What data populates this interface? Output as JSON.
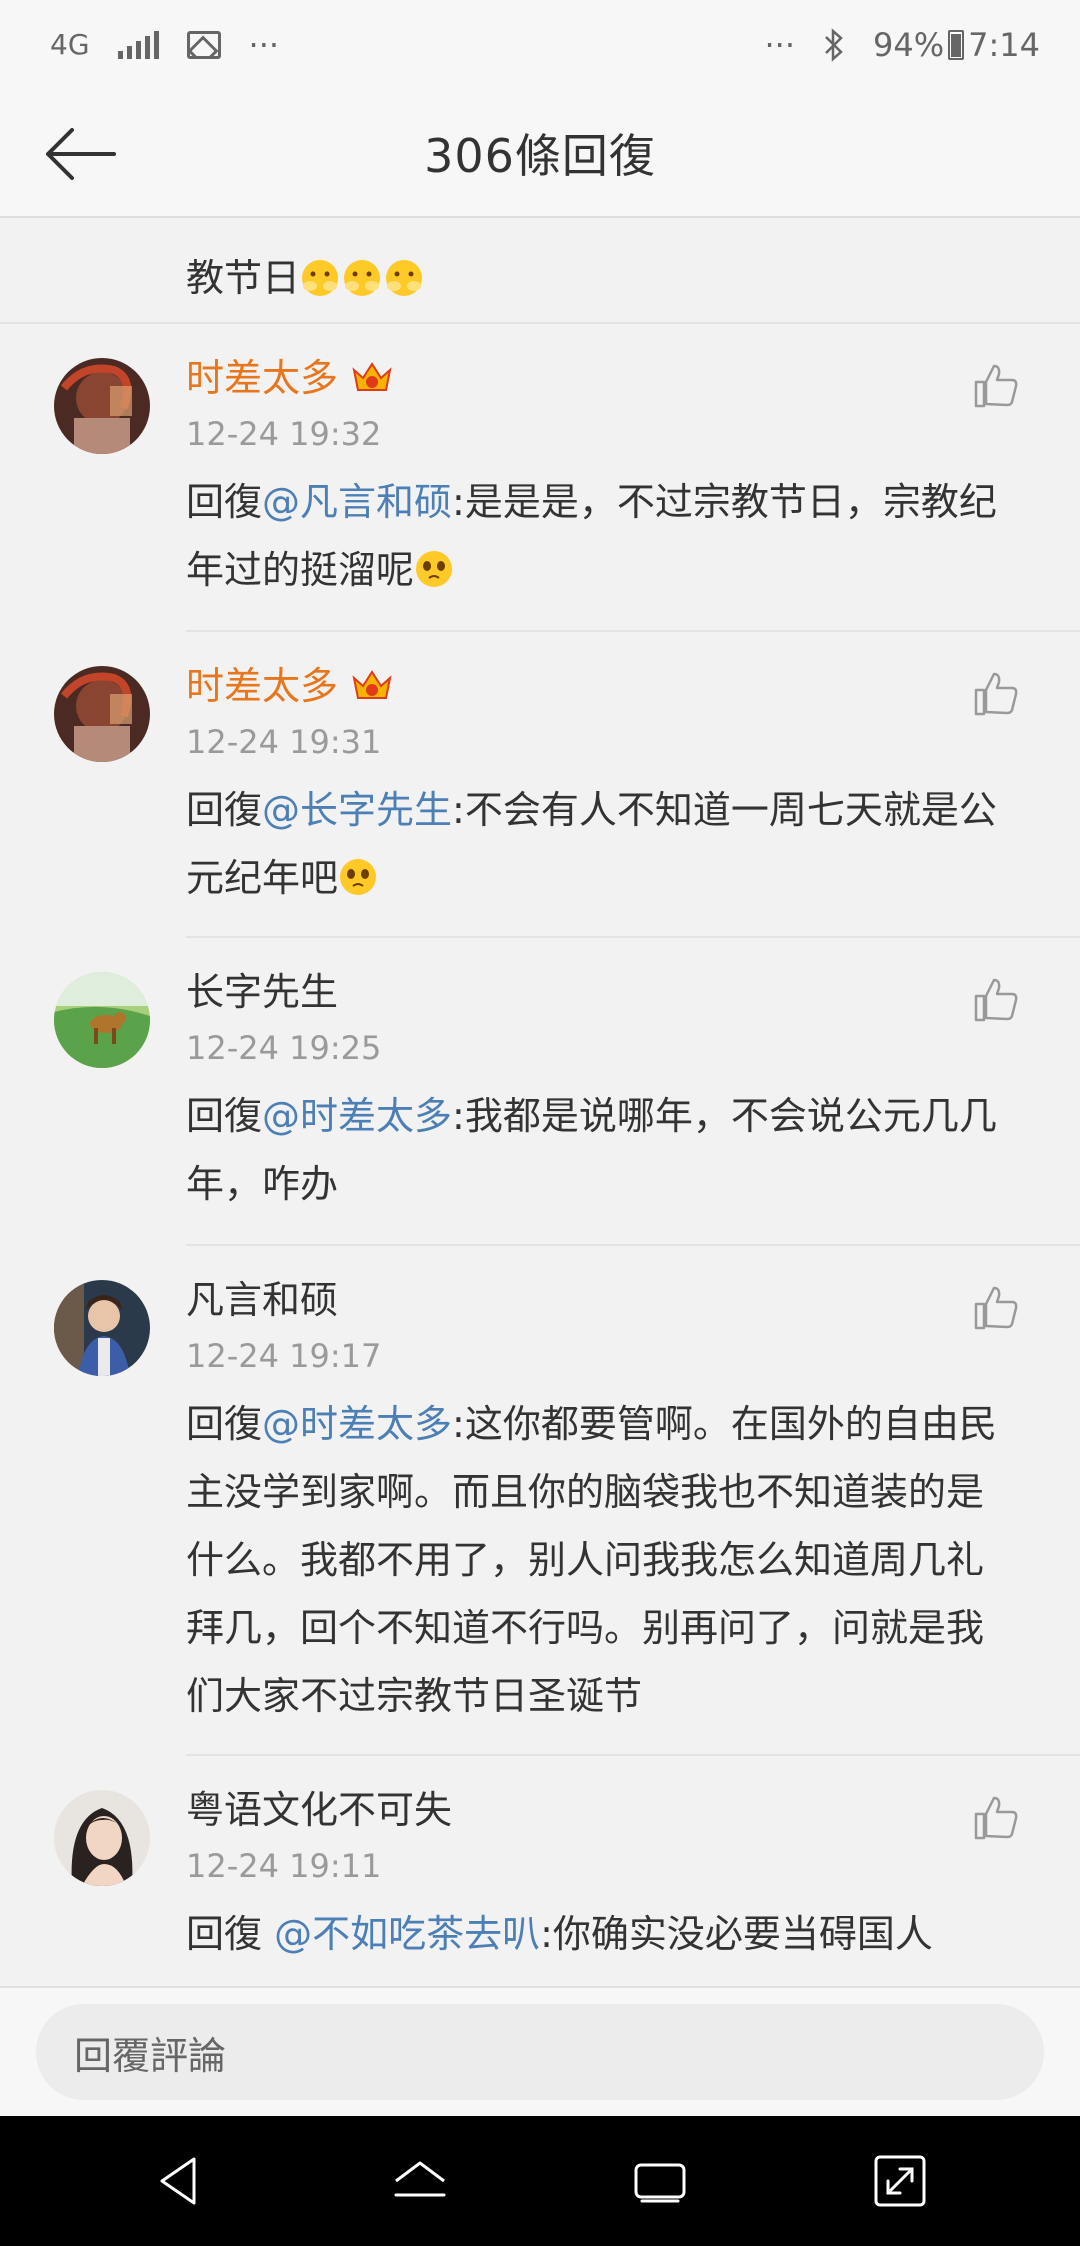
{
  "status_bar": {
    "network": "4G",
    "more_left": "···",
    "more_right": "···",
    "battery": "94%",
    "time": "7:14"
  },
  "header": {
    "title": "306條回復"
  },
  "partial_comment": {
    "text": "教节日"
  },
  "comments": [
    {
      "name": "时差太多",
      "time": "12-24 19:32",
      "reply_prefix": "回復",
      "mention": "@凡言和硕",
      "text": ":是是是，不过宗教节日，宗教纪年过的挺溜呢"
    },
    {
      "name": "时差太多",
      "time": "12-24 19:31",
      "reply_prefix": "回復",
      "mention": "@长字先生",
      "text": ":不会有人不知道一周七天就是公元纪年吧"
    },
    {
      "name": "长字先生",
      "time": "12-24 19:25",
      "reply_prefix": "回復",
      "mention": "@时差太多",
      "text": ":我都是说哪年，不会说公元几几年，咋办"
    },
    {
      "name": "凡言和硕",
      "time": "12-24 19:17",
      "reply_prefix": "回復",
      "mention": "@时差太多",
      "text": ":这你都要管啊。在国外的自由民主没学到家啊。而且你的脑袋我也不知道装的是什么。我都不用了，别人问我我怎么知道周几礼拜几，回个不知道不行吗。别再问了，问就是我们大家不过宗教节日圣诞节"
    },
    {
      "name": "粤语文化不可失",
      "time": "12-24 19:11",
      "reply_prefix": "回復 ",
      "mention": "@不如吃茶去叭",
      "text": ":你确实没必要当碍国人"
    }
  ],
  "reply_bar": {
    "placeholder": "回覆評論"
  },
  "colors": {
    "vip_name": "#e8761c",
    "mention": "#4c7fb5",
    "timestamp": "#9a9a9a"
  }
}
